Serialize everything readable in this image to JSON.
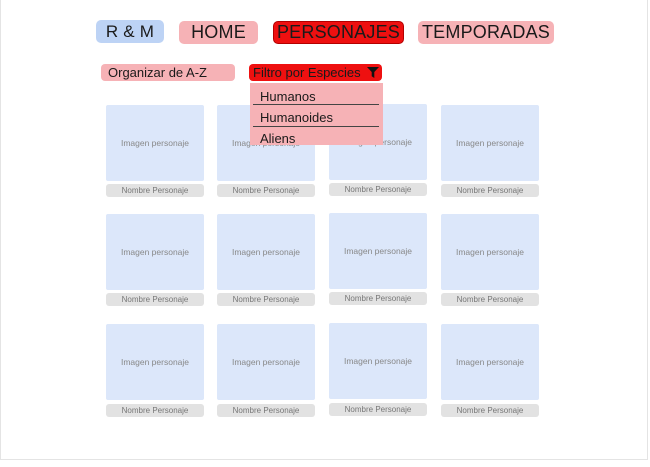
{
  "nav": {
    "logo": "R & M",
    "home": "HOME",
    "personajes": "PERSONAJES",
    "temporadas": "TEMPORADAS"
  },
  "toolbar": {
    "sort_label": "Organizar de A-Z",
    "filter_label": "Filtro por Especies"
  },
  "filter_options": [
    "Humanos",
    "Humanoides",
    "Aliens"
  ],
  "card": {
    "image_placeholder": "Imagen personaje",
    "name_placeholder": "Nombre Personaje"
  },
  "colors": {
    "active_red": "#ee1010",
    "pink": "#f6b2b6",
    "blue": "#bdd3f5",
    "card_blue": "#dce7fa"
  },
  "icons": {
    "filter": "funnel-icon"
  }
}
